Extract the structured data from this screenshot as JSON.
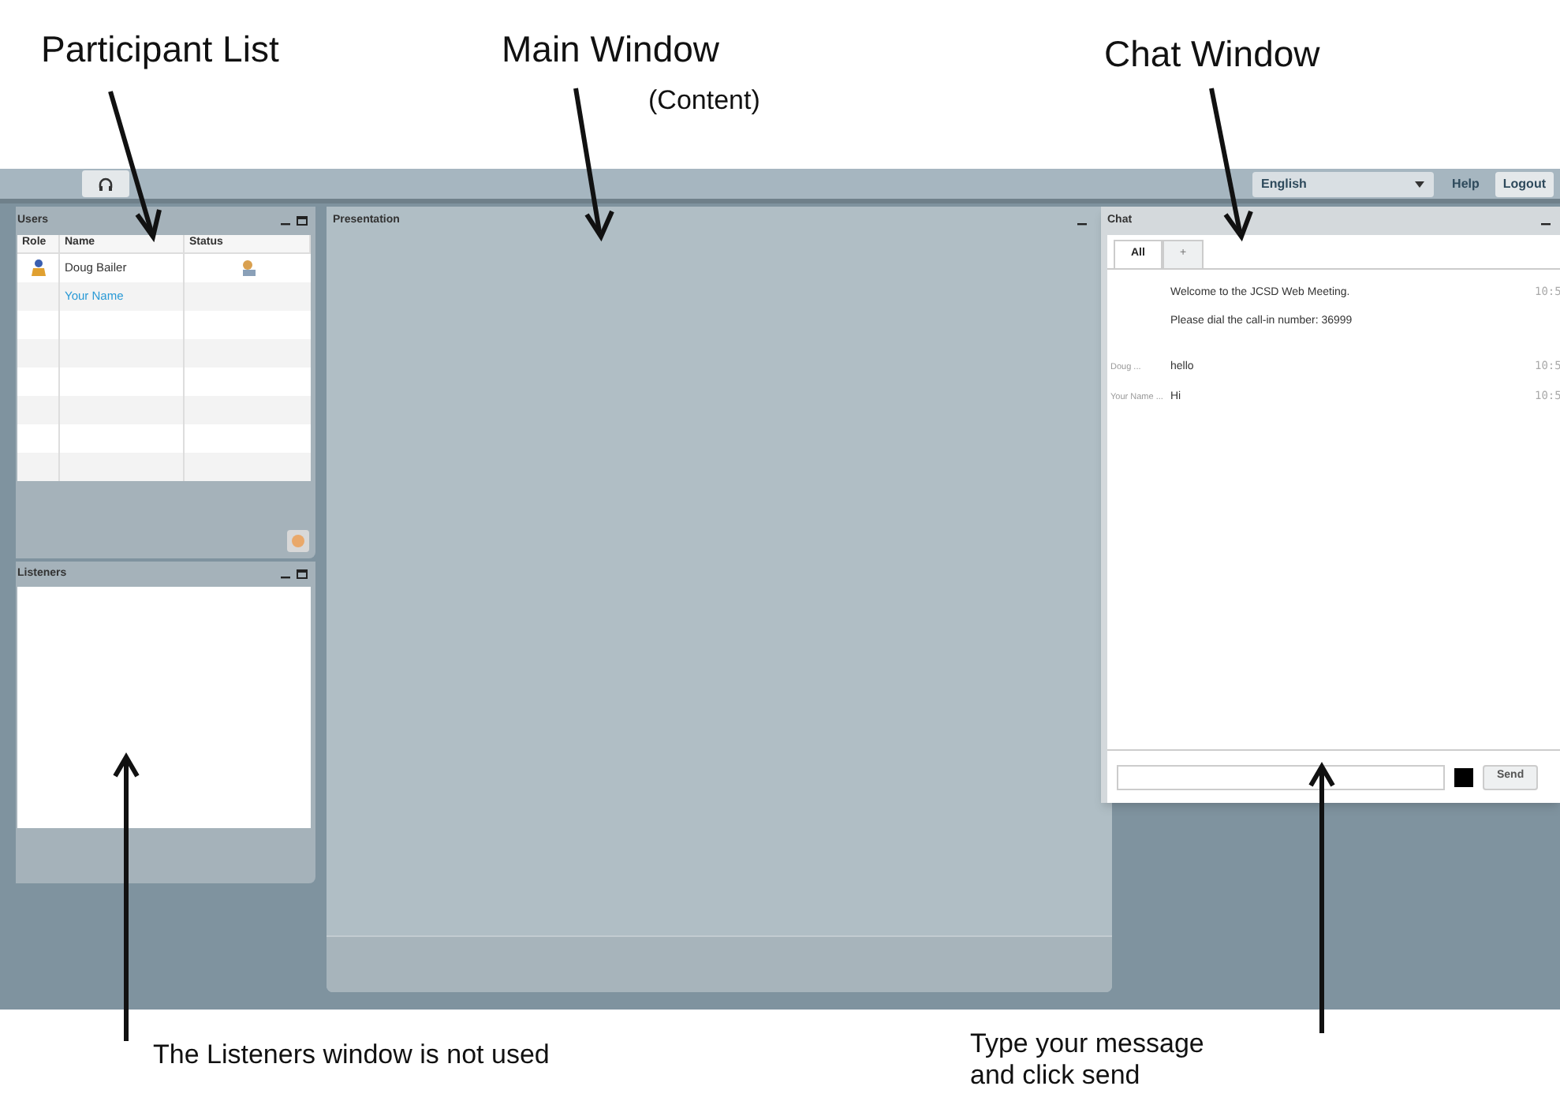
{
  "annotations": [
    {
      "text": "Participant List"
    },
    {
      "text": "Main Window"
    },
    {
      "text": "(Content)"
    },
    {
      "text": "Chat Window"
    },
    {
      "text": "The Listeners window is not used"
    },
    {
      "text": "Type your message and click send"
    }
  ],
  "toolbar": {
    "language": "English",
    "help": "Help",
    "logout": "Logout"
  },
  "users": {
    "title": "Users",
    "columns": [
      "Role",
      "Name",
      "Status"
    ],
    "rows": [
      {
        "name": "Doug Bailer",
        "moderator": true,
        "presenter": true,
        "me": false
      },
      {
        "name": "Your Name",
        "moderator": false,
        "presenter": false,
        "me": true
      }
    ]
  },
  "listeners": {
    "title": "Listeners"
  },
  "presentation": {
    "title": "Presentation"
  },
  "chat": {
    "title": "Chat",
    "tabs": [
      {
        "label": "All",
        "selected": true
      },
      {
        "label": "+",
        "selected": false
      }
    ],
    "messages": [
      {
        "text": "Welcome to the JCSD Web Meeting.",
        "time": "10:5"
      },
      {
        "text": "Please dial the call-in number:  36999"
      },
      {
        "sender": "Doug ...",
        "text": "hello",
        "time": "10:5"
      },
      {
        "sender": "Your Name ...",
        "text": "Hi",
        "time": "10:5"
      }
    ],
    "send": "Send"
  }
}
